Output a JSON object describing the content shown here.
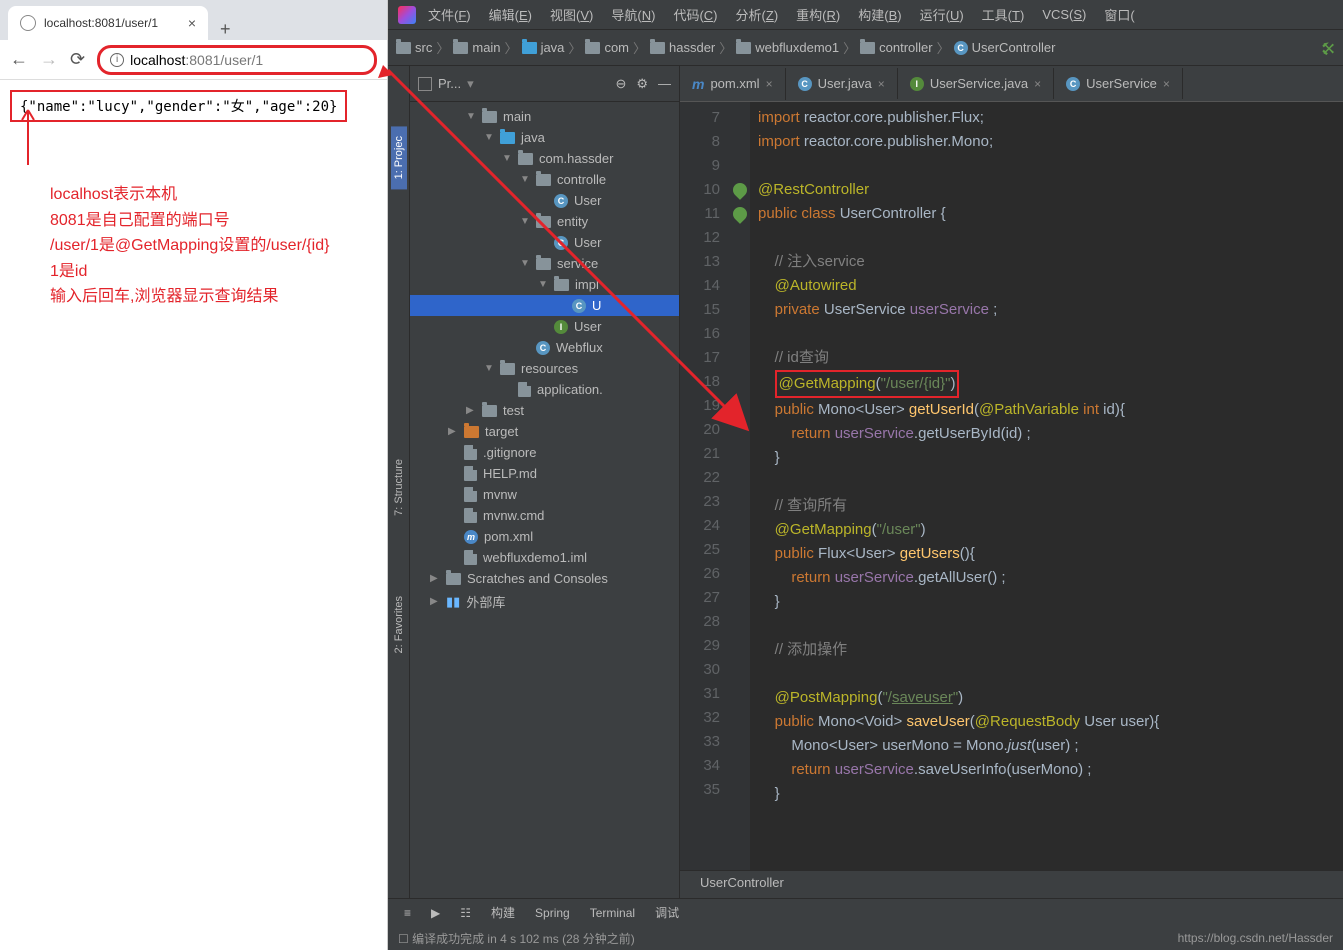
{
  "browser": {
    "tabTitle": "localhost:8081/user/1",
    "url": {
      "host": "localhost",
      "portPath": ":8081/user/1"
    },
    "jsonResult": "{\"name\":\"lucy\",\"gender\":\"女\",\"age\":20}",
    "annotation": [
      "localhost表示本机",
      "8081是自己配置的端口号",
      "/user/1是@GetMapping设置的/user/{id}",
      "1是id",
      "输入后回车,浏览器显示查询结果"
    ]
  },
  "ide": {
    "menus": [
      "文件(F)",
      "编辑(E)",
      "视图(V)",
      "导航(N)",
      "代码(C)",
      "分析(Z)",
      "重构(R)",
      "构建(B)",
      "运行(U)",
      "工具(T)",
      "VCS(S)",
      "窗口("
    ],
    "bread": [
      "src",
      "main",
      "java",
      "com",
      "hassder",
      "webfluxdemo1",
      "controller",
      "UserController"
    ],
    "projectLabel": "Pr...",
    "sideTabs": [
      "1: Projec",
      "7: Structure",
      "2: Favorites"
    ],
    "editorTabs": [
      {
        "icon": "m",
        "label": "pom.xml"
      },
      {
        "icon": "c",
        "label": "User.java"
      },
      {
        "icon": "i",
        "label": "UserService.java"
      },
      {
        "icon": "c",
        "label": "UserService"
      }
    ],
    "tree": [
      {
        "d": 2,
        "arr": "▼",
        "ico": "fld",
        "lab": "main"
      },
      {
        "d": 3,
        "arr": "▼",
        "ico": "fldb",
        "lab": "java"
      },
      {
        "d": 4,
        "arr": "▼",
        "ico": "fld",
        "lab": "com.hassder"
      },
      {
        "d": 5,
        "arr": "▼",
        "ico": "fld",
        "lab": "controlle"
      },
      {
        "d": 6,
        "arr": "",
        "ico": "cls",
        "lab": "User"
      },
      {
        "d": 5,
        "arr": "▼",
        "ico": "fld",
        "lab": "entity"
      },
      {
        "d": 6,
        "arr": "",
        "ico": "cls",
        "lab": "User"
      },
      {
        "d": 5,
        "arr": "▼",
        "ico": "fld",
        "lab": "service"
      },
      {
        "d": 6,
        "arr": "▼",
        "ico": "fld",
        "lab": "impl"
      },
      {
        "d": 7,
        "arr": "",
        "ico": "cls",
        "lab": "U",
        "sel": true
      },
      {
        "d": 6,
        "arr": "",
        "ico": "clsg",
        "lab": "User"
      },
      {
        "d": 5,
        "arr": "",
        "ico": "cls",
        "lab": "Webflux"
      },
      {
        "d": 3,
        "arr": "▼",
        "ico": "fld",
        "lab": "resources"
      },
      {
        "d": 4,
        "arr": "",
        "ico": "file",
        "lab": "application."
      },
      {
        "d": 2,
        "arr": "▶",
        "ico": "fld",
        "lab": "test"
      },
      {
        "d": 1,
        "arr": "▶",
        "ico": "fldo",
        "lab": "target"
      },
      {
        "d": 1,
        "arr": "",
        "ico": "file",
        "lab": ".gitignore"
      },
      {
        "d": 1,
        "arr": "",
        "ico": "file",
        "lab": "HELP.md"
      },
      {
        "d": 1,
        "arr": "",
        "ico": "file",
        "lab": "mvnw"
      },
      {
        "d": 1,
        "arr": "",
        "ico": "file",
        "lab": "mvnw.cmd"
      },
      {
        "d": 1,
        "arr": "",
        "ico": "m",
        "lab": "pom.xml"
      },
      {
        "d": 1,
        "arr": "",
        "ico": "file",
        "lab": "webfluxdemo1.iml"
      },
      {
        "d": 0,
        "arr": "▶",
        "ico": "fld",
        "lab": "Scratches and Consoles"
      },
      {
        "d": 0,
        "arr": "▶",
        "ico": "lib",
        "lab": "外部库"
      }
    ],
    "lineStart": 7,
    "code": [
      {
        "n": 7,
        "h": "<span class='kw'>import </span>reactor.core.publisher.Flux;"
      },
      {
        "n": 8,
        "h": "<span class='kw'>import </span>reactor.core.publisher.Mono;"
      },
      {
        "n": 9,
        "h": ""
      },
      {
        "n": 10,
        "h": "<span class='ann'>@RestController</span>",
        "mk": "bean"
      },
      {
        "n": 11,
        "h": "<span class='kw'>public class </span>UserController {",
        "mk": "bean"
      },
      {
        "n": 12,
        "h": ""
      },
      {
        "n": 13,
        "h": "    <span class='cmt'>// 注入service</span>"
      },
      {
        "n": 14,
        "h": "    <span class='ann'>@Autowired</span>"
      },
      {
        "n": 15,
        "h": "    <span class='kw'>private </span>UserService <span class='fld'>userService</span> ;"
      },
      {
        "n": 16,
        "h": ""
      },
      {
        "n": 17,
        "h": "    <span class='cmt'>// id查询</span>"
      },
      {
        "n": 18,
        "h": "    <span class='hl-box'><span class='ann'>@GetMapping</span>(<span class='str'>\"/user/{id}\"</span>)</span>"
      },
      {
        "n": 19,
        "h": "    <span class='kw'>public </span>Mono&lt;User&gt; <span class='fn'>getUserId</span>(<span class='ann'>@PathVariable</span> <span class='kw'>int </span>id){"
      },
      {
        "n": 20,
        "h": "        <span class='kw'>return </span><span class='fld'>userService</span>.getUserById(id) ;"
      },
      {
        "n": 21,
        "h": "    }"
      },
      {
        "n": 22,
        "h": ""
      },
      {
        "n": 23,
        "h": "    <span class='cmt'>// 查询所有</span>"
      },
      {
        "n": 24,
        "h": "    <span class='ann'>@GetMapping</span>(<span class='str'>\"/user\"</span>)"
      },
      {
        "n": 25,
        "h": "    <span class='kw'>public </span>Flux&lt;User&gt; <span class='fn'>getUsers</span>(){"
      },
      {
        "n": 26,
        "h": "        <span class='kw'>return </span><span class='fld'>userService</span>.getAllUser() ;"
      },
      {
        "n": 27,
        "h": "    }"
      },
      {
        "n": 28,
        "h": ""
      },
      {
        "n": 29,
        "h": "    <span class='cmt'>// 添加操作</span>"
      },
      {
        "n": 30,
        "h": ""
      },
      {
        "n": 31,
        "h": "    <span class='ann'>@PostMapping</span>(<span class='str'>\"/</span><span class='strU'>saveuser</span><span class='str'>\"</span>)"
      },
      {
        "n": 32,
        "h": "    <span class='kw'>public </span>Mono&lt;Void&gt; <span class='fn'>saveUser</span>(<span class='ann'>@RequestBody</span> User user){"
      },
      {
        "n": 33,
        "h": "        Mono&lt;User&gt; userMono = Mono.<span style='font-style:italic'>just</span>(user) ;"
      },
      {
        "n": 34,
        "h": "        <span class='kw'>return </span><span class='fld'>userService</span>.saveUserInfo(userMono) ;"
      },
      {
        "n": 35,
        "h": "    }"
      }
    ],
    "crumb": "UserController",
    "bottomTabs": [
      "0: Messages",
      "4: Run",
      "6: TODO",
      "构建",
      "Spring",
      "Terminal",
      "调试"
    ],
    "status": "编译成功完成 in 4 s 102 ms (28 分钟之前)",
    "watermark": "https://blog.csdn.net/Hassder"
  }
}
